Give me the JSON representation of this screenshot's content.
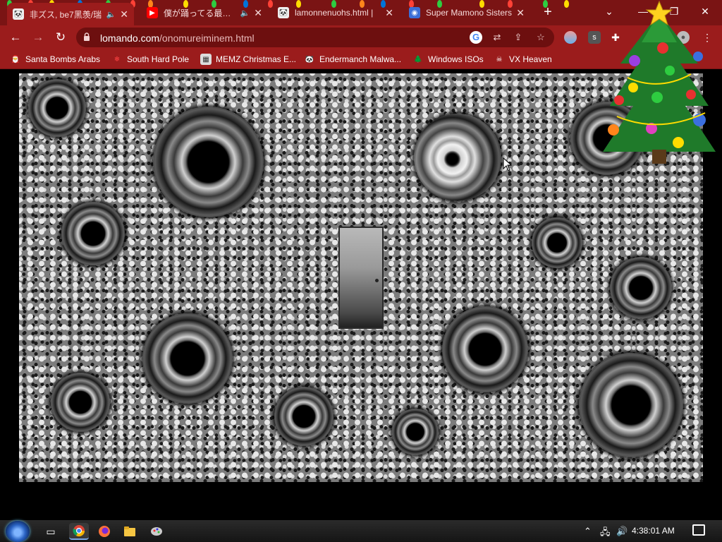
{
  "tabs": [
    {
      "title": "非ズス, be7黑羡/瑞",
      "favicon": "panda",
      "audio": "🔈"
    },
    {
      "title": "僕が踊ってる最中に",
      "favicon": "youtube",
      "audio": "🔈"
    },
    {
      "title": "lamonnenuohs.html |",
      "favicon": "panda",
      "audio": ""
    },
    {
      "title": "Super Mamono Sisters",
      "favicon": "globe",
      "audio": ""
    }
  ],
  "new_tab_label": "+",
  "window_controls": {
    "minimize": "—",
    "restore": "❐",
    "close": "✕"
  },
  "toolbar": {
    "url_domain": "lomando.com",
    "url_path": "/onomureiminem.html",
    "back": "←",
    "forward": "→",
    "reload": "↻"
  },
  "bookmarks": [
    {
      "label": "Santa Bombs Arabs",
      "icon": "santa-icon"
    },
    {
      "label": "South Hard Pole",
      "icon": "snowflake-icon"
    },
    {
      "label": "MEMZ Christmas E...",
      "icon": "memz-icon"
    },
    {
      "label": "Endermanch Malwa...",
      "icon": "panda-icon"
    },
    {
      "label": "Windows ISOs",
      "icon": "tree-icon"
    },
    {
      "label": "VX Heaven",
      "icon": "skull-icon"
    }
  ],
  "taskbar": {
    "clock": "4:38:01 AM",
    "apps": [
      "task-view-icon",
      "chrome-icon",
      "firefox-icon",
      "explorer-icon",
      "paint-icon"
    ]
  },
  "colors": {
    "chrome_bg": "#9b1c1c",
    "tabstrip_bg": "#7a1414",
    "accent": "#ffffff"
  }
}
